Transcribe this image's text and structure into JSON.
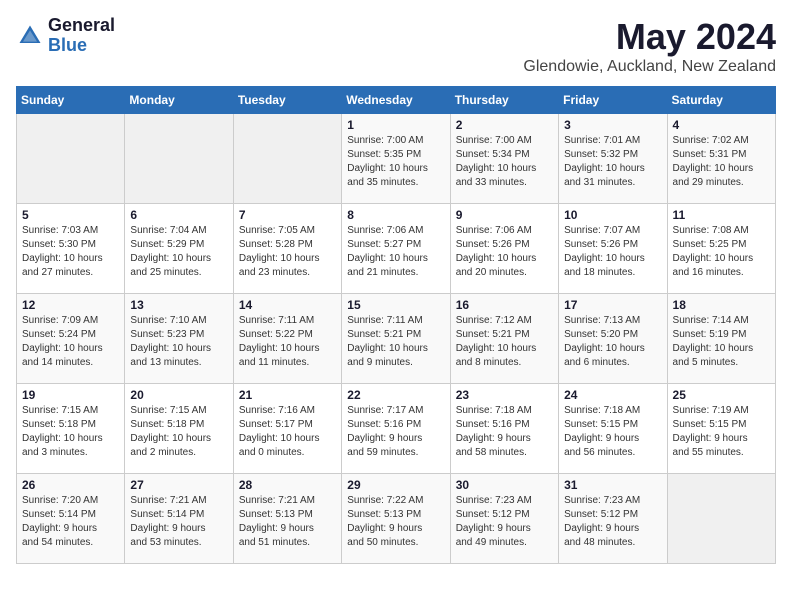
{
  "header": {
    "logo_general": "General",
    "logo_blue": "Blue",
    "title": "May 2024",
    "location": "Glendowie, Auckland, New Zealand"
  },
  "weekdays": [
    "Sunday",
    "Monday",
    "Tuesday",
    "Wednesday",
    "Thursday",
    "Friday",
    "Saturday"
  ],
  "weeks": [
    [
      {
        "day": "",
        "info": ""
      },
      {
        "day": "",
        "info": ""
      },
      {
        "day": "",
        "info": ""
      },
      {
        "day": "1",
        "info": "Sunrise: 7:00 AM\nSunset: 5:35 PM\nDaylight: 10 hours\nand 35 minutes."
      },
      {
        "day": "2",
        "info": "Sunrise: 7:00 AM\nSunset: 5:34 PM\nDaylight: 10 hours\nand 33 minutes."
      },
      {
        "day": "3",
        "info": "Sunrise: 7:01 AM\nSunset: 5:32 PM\nDaylight: 10 hours\nand 31 minutes."
      },
      {
        "day": "4",
        "info": "Sunrise: 7:02 AM\nSunset: 5:31 PM\nDaylight: 10 hours\nand 29 minutes."
      }
    ],
    [
      {
        "day": "5",
        "info": "Sunrise: 7:03 AM\nSunset: 5:30 PM\nDaylight: 10 hours\nand 27 minutes."
      },
      {
        "day": "6",
        "info": "Sunrise: 7:04 AM\nSunset: 5:29 PM\nDaylight: 10 hours\nand 25 minutes."
      },
      {
        "day": "7",
        "info": "Sunrise: 7:05 AM\nSunset: 5:28 PM\nDaylight: 10 hours\nand 23 minutes."
      },
      {
        "day": "8",
        "info": "Sunrise: 7:06 AM\nSunset: 5:27 PM\nDaylight: 10 hours\nand 21 minutes."
      },
      {
        "day": "9",
        "info": "Sunrise: 7:06 AM\nSunset: 5:26 PM\nDaylight: 10 hours\nand 20 minutes."
      },
      {
        "day": "10",
        "info": "Sunrise: 7:07 AM\nSunset: 5:26 PM\nDaylight: 10 hours\nand 18 minutes."
      },
      {
        "day": "11",
        "info": "Sunrise: 7:08 AM\nSunset: 5:25 PM\nDaylight: 10 hours\nand 16 minutes."
      }
    ],
    [
      {
        "day": "12",
        "info": "Sunrise: 7:09 AM\nSunset: 5:24 PM\nDaylight: 10 hours\nand 14 minutes."
      },
      {
        "day": "13",
        "info": "Sunrise: 7:10 AM\nSunset: 5:23 PM\nDaylight: 10 hours\nand 13 minutes."
      },
      {
        "day": "14",
        "info": "Sunrise: 7:11 AM\nSunset: 5:22 PM\nDaylight: 10 hours\nand 11 minutes."
      },
      {
        "day": "15",
        "info": "Sunrise: 7:11 AM\nSunset: 5:21 PM\nDaylight: 10 hours\nand 9 minutes."
      },
      {
        "day": "16",
        "info": "Sunrise: 7:12 AM\nSunset: 5:21 PM\nDaylight: 10 hours\nand 8 minutes."
      },
      {
        "day": "17",
        "info": "Sunrise: 7:13 AM\nSunset: 5:20 PM\nDaylight: 10 hours\nand 6 minutes."
      },
      {
        "day": "18",
        "info": "Sunrise: 7:14 AM\nSunset: 5:19 PM\nDaylight: 10 hours\nand 5 minutes."
      }
    ],
    [
      {
        "day": "19",
        "info": "Sunrise: 7:15 AM\nSunset: 5:18 PM\nDaylight: 10 hours\nand 3 minutes."
      },
      {
        "day": "20",
        "info": "Sunrise: 7:15 AM\nSunset: 5:18 PM\nDaylight: 10 hours\nand 2 minutes."
      },
      {
        "day": "21",
        "info": "Sunrise: 7:16 AM\nSunset: 5:17 PM\nDaylight: 10 hours\nand 0 minutes."
      },
      {
        "day": "22",
        "info": "Sunrise: 7:17 AM\nSunset: 5:16 PM\nDaylight: 9 hours\nand 59 minutes."
      },
      {
        "day": "23",
        "info": "Sunrise: 7:18 AM\nSunset: 5:16 PM\nDaylight: 9 hours\nand 58 minutes."
      },
      {
        "day": "24",
        "info": "Sunrise: 7:18 AM\nSunset: 5:15 PM\nDaylight: 9 hours\nand 56 minutes."
      },
      {
        "day": "25",
        "info": "Sunrise: 7:19 AM\nSunset: 5:15 PM\nDaylight: 9 hours\nand 55 minutes."
      }
    ],
    [
      {
        "day": "26",
        "info": "Sunrise: 7:20 AM\nSunset: 5:14 PM\nDaylight: 9 hours\nand 54 minutes."
      },
      {
        "day": "27",
        "info": "Sunrise: 7:21 AM\nSunset: 5:14 PM\nDaylight: 9 hours\nand 53 minutes."
      },
      {
        "day": "28",
        "info": "Sunrise: 7:21 AM\nSunset: 5:13 PM\nDaylight: 9 hours\nand 51 minutes."
      },
      {
        "day": "29",
        "info": "Sunrise: 7:22 AM\nSunset: 5:13 PM\nDaylight: 9 hours\nand 50 minutes."
      },
      {
        "day": "30",
        "info": "Sunrise: 7:23 AM\nSunset: 5:12 PM\nDaylight: 9 hours\nand 49 minutes."
      },
      {
        "day": "31",
        "info": "Sunrise: 7:23 AM\nSunset: 5:12 PM\nDaylight: 9 hours\nand 48 minutes."
      },
      {
        "day": "",
        "info": ""
      }
    ]
  ]
}
